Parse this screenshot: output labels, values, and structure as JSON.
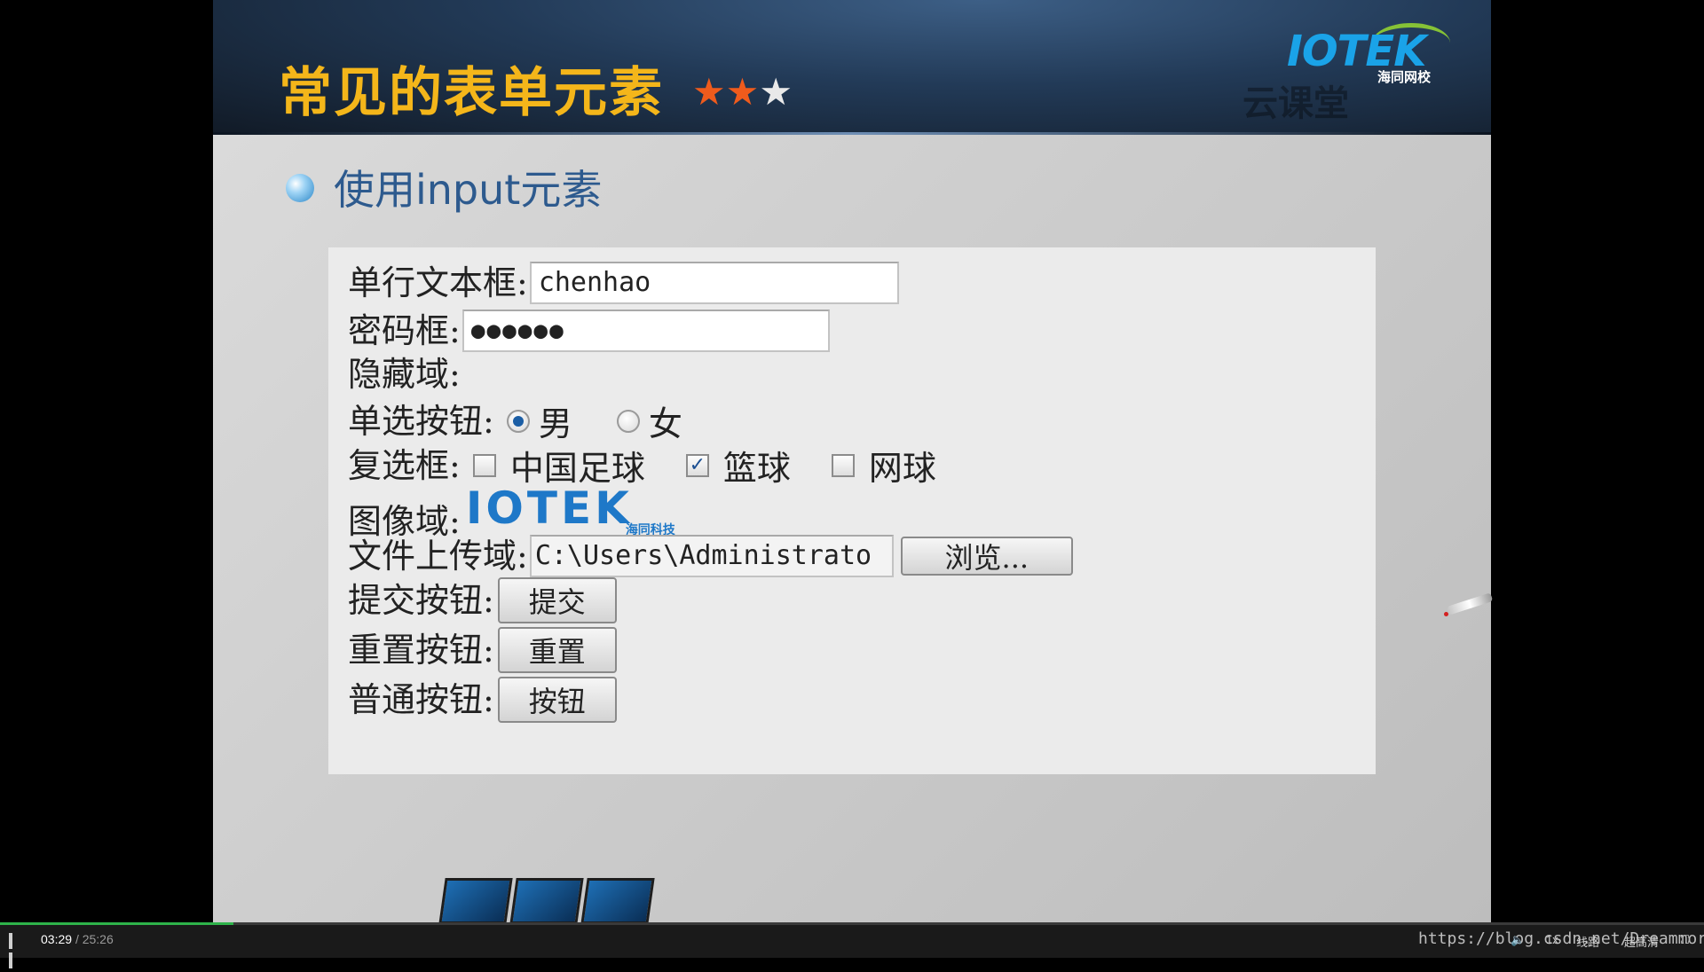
{
  "slide": {
    "title": "常见的表单元素",
    "stars": {
      "filled": 2,
      "total": 3
    },
    "logo": {
      "text": "IOTEK",
      "subtitle": "海同网校"
    },
    "watermark": "云课堂",
    "section_heading": "使用input元素"
  },
  "form": {
    "text_label": "单行文本框:",
    "text_value": "chenhao",
    "password_label": "密码框:",
    "password_value": "●●●●●●",
    "hidden_label": "隐藏域:",
    "radio_label": "单选按钮:",
    "radio_options": [
      {
        "label": "男",
        "checked": true
      },
      {
        "label": "女",
        "checked": false
      }
    ],
    "checkbox_label": "复选框:",
    "checkbox_options": [
      {
        "label": "中国足球",
        "checked": false
      },
      {
        "label": "篮球",
        "checked": true
      },
      {
        "label": "网球",
        "checked": false
      }
    ],
    "image_label": "图像域:",
    "image_text": "IOTEK",
    "image_subtext": "海同科技",
    "file_label": "文件上传域:",
    "file_value": "C:\\Users\\Administrato",
    "browse_label": "浏览...",
    "submit_row_label": "提交按钮:",
    "submit_button": "提交",
    "reset_row_label": "重置按钮:",
    "reset_button": "重置",
    "normal_row_label": "普通按钮:",
    "normal_button": "按钮"
  },
  "player": {
    "current_time": "03:29",
    "separator": "/",
    "total_time": "25:26",
    "progress": 0.137,
    "url_overlay": "https://blog.csdn.net/Dreammor",
    "controls": [
      "1x",
      "线路",
      "超高清"
    ]
  }
}
